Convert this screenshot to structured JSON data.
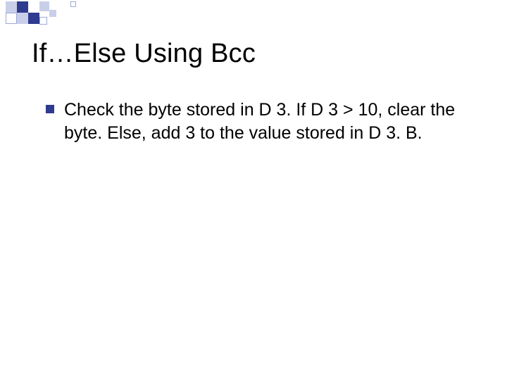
{
  "slide": {
    "title": "If…Else Using Bcc",
    "bullets": [
      {
        "text": "Check the byte stored in D 3.  If D 3 > 10, clear the byte.  Else, add 3 to the value stored in D 3. B."
      }
    ]
  },
  "theme": {
    "accent_dark": "#2f3b8f",
    "accent_mid": "#9ea8d8",
    "accent_light": "#c9cfe9"
  }
}
